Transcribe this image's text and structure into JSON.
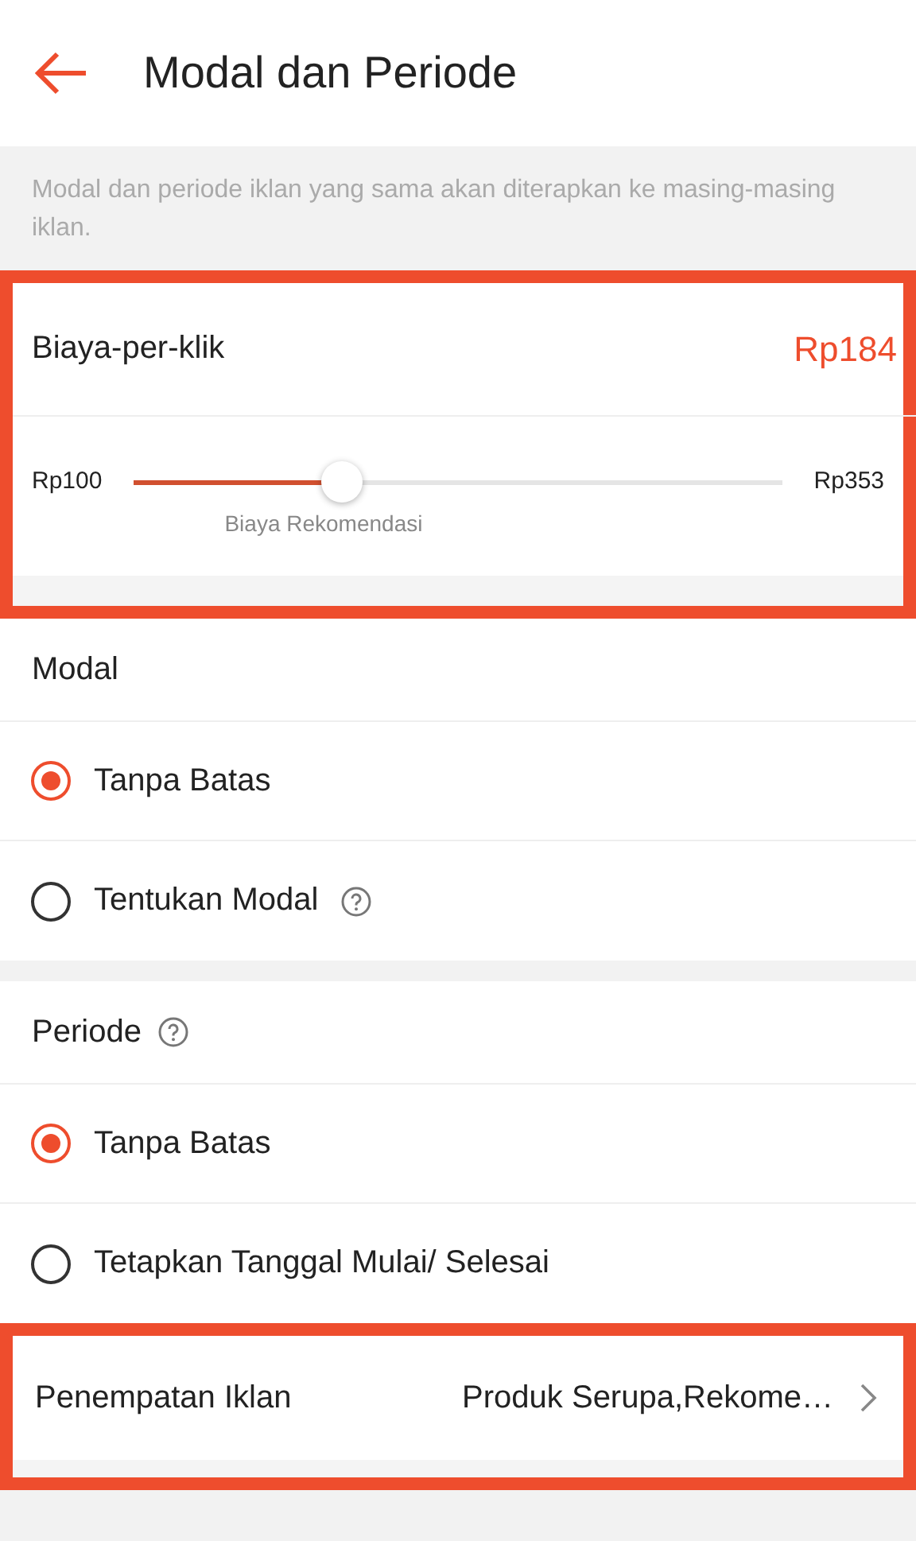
{
  "header": {
    "title": "Modal dan Periode"
  },
  "note": "Modal dan periode iklan yang sama akan diterapkan ke masing-masing iklan.",
  "cpc": {
    "highlighted": true,
    "label": "Biaya-per-klik",
    "value": "Rp184",
    "min": "Rp100",
    "max": "Rp353",
    "level": 0.32,
    "caption": "Biaya Rekomendasi"
  },
  "sections": [
    {
      "title": "Modal",
      "help": false,
      "options": [
        {
          "label": "Tanpa Batas",
          "selected": true,
          "help": false
        },
        {
          "label": "Tentukan Modal",
          "selected": false,
          "help": true
        }
      ]
    },
    {
      "title": "Periode",
      "help": true,
      "options": [
        {
          "label": "Tanpa Batas",
          "selected": true,
          "help": false
        },
        {
          "label": "Tetapkan Tanggal Mulai/ Selesai",
          "selected": false,
          "help": false
        }
      ]
    }
  ],
  "placement": {
    "highlighted": true,
    "label": "Penempatan Iklan",
    "value": "Produk Serupa,Rekome…"
  }
}
